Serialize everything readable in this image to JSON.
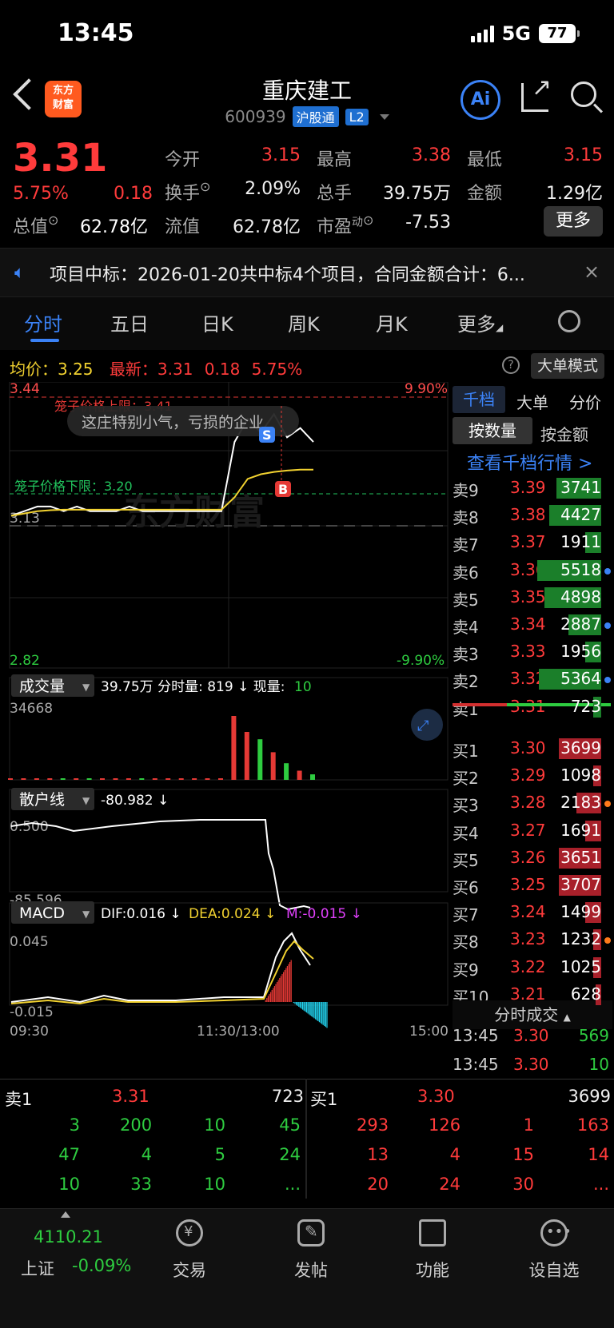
{
  "status": {
    "time": "13:45",
    "network": "5G",
    "battery": "77"
  },
  "header": {
    "logo_line1": "东方",
    "logo_line2": "财富",
    "name": "重庆建工",
    "code": "600939",
    "tag1": "沪股通",
    "tag2": "L2",
    "ai_label": "Ai"
  },
  "quote": {
    "price": "3.31",
    "pct": "5.75%",
    "change": "0.18",
    "open_label": "今开",
    "open": "3.15",
    "high_label": "最高",
    "high": "3.38",
    "low_label": "最低",
    "low": "3.15",
    "turnover_label": "换手",
    "turnover": "2.09%",
    "volume_label": "总手",
    "volume": "39.75万",
    "amount_label": "金额",
    "amount": "1.29亿",
    "mktcap_label": "总值",
    "mktcap": "62.78亿",
    "float_label": "流值",
    "float": "62.78亿",
    "pe_label": "市盈",
    "pe_sup": "动",
    "pe": "-7.53",
    "more": "更多"
  },
  "notice": {
    "text": "项目中标：2026-01-20共中标4个项目，合同金额合计：6...",
    "close": "×"
  },
  "tabs": [
    "分时",
    "五日",
    "日K",
    "周K",
    "月K",
    "更多"
  ],
  "chart_head": {
    "avg_label": "均价：",
    "avg": "3.25",
    "last_label": "最新：",
    "last": "3.31",
    "chg": "0.18",
    "pct": "5.75%",
    "big_order": "大单模式",
    "help": "?"
  },
  "chart_labels": {
    "y_top": "3.44",
    "y_mid": "3.13",
    "y_bot": "2.82",
    "pct_top": "9.90%",
    "pct_bot": "-9.90%",
    "upper_limit": "笼子价格上限：3.41",
    "lower_limit": "笼子价格下限：3.20",
    "toast": "这庄特别小气，亏损的企业",
    "watermark": "东方财富",
    "vol_title": "成交量",
    "vol_info": "39.75万 分时量: 819 ↓ 现量: ",
    "vol_now": "10",
    "vol_max": "34668",
    "retail_title": "散户线",
    "retail_val": "-80.982 ↓",
    "retail_top": "0.500",
    "retail_bot": "-85.596",
    "macd_title": "MACD",
    "dif": "DIF:0.016 ↓",
    "dea": "DEA:0.024 ↓",
    "m": "M:-0.015 ↓",
    "macd_top": "0.045",
    "macd_bot": "-0.015",
    "t_start": "09:30",
    "t_mid": "11:30/13:00",
    "t_end": "15:00",
    "marker_s": "S",
    "marker_b": "B"
  },
  "chart_data": {
    "type": "line",
    "title": "",
    "price_range": [
      2.82,
      3.44
    ],
    "prev_close": 3.13,
    "series": [
      {
        "name": "最新",
        "values": [
          3.15,
          3.16,
          3.17,
          3.17,
          3.16,
          3.17,
          3.16,
          3.16,
          3.16,
          3.17,
          3.16,
          3.16,
          3.16,
          3.16,
          3.16,
          3.16,
          3.16,
          3.31,
          3.36,
          3.33,
          3.37,
          3.32,
          3.34,
          3.31
        ]
      },
      {
        "name": "均价",
        "values": [
          3.15,
          3.155,
          3.16,
          3.162,
          3.163,
          3.163,
          3.163,
          3.163,
          3.163,
          3.163,
          3.163,
          3.163,
          3.163,
          3.163,
          3.163,
          3.163,
          3.163,
          3.19,
          3.23,
          3.24,
          3.245,
          3.248,
          3.25,
          3.25
        ]
      }
    ],
    "volume": [
      40,
      80,
      20,
      30,
      60,
      20,
      30,
      40,
      20,
      30,
      20,
      20,
      15,
      15,
      20,
      15,
      10,
      34668,
      26000,
      22000,
      15000,
      9000,
      5000,
      3000
    ],
    "ylim": [
      2.82,
      3.44
    ]
  },
  "panel": {
    "tab1": "千档",
    "tab2": "大单",
    "tab3": "分价",
    "by_qty": "按数量",
    "by_amt": "按金额",
    "view_link": "查看千档行情 >",
    "asks": [
      {
        "label": "卖9",
        "price": "3.39",
        "vol": "3741",
        "bar": 0.33,
        "dot": ""
      },
      {
        "label": "卖8",
        "price": "3.38",
        "vol": "4427",
        "bar": 0.38,
        "dot": ""
      },
      {
        "label": "卖7",
        "price": "3.37",
        "vol": "1911",
        "bar": 0.12,
        "dot": ""
      },
      {
        "label": "卖6",
        "price": "3.36",
        "vol": "5518",
        "bar": 0.47,
        "dot": "#3b82f6"
      },
      {
        "label": "卖5",
        "price": "3.35",
        "vol": "4898",
        "bar": 0.42,
        "dot": ""
      },
      {
        "label": "卖4",
        "price": "3.34",
        "vol": "2887",
        "bar": 0.24,
        "dot": "#3b82f6"
      },
      {
        "label": "卖3",
        "price": "3.33",
        "vol": "1956",
        "bar": 0.12,
        "dot": ""
      },
      {
        "label": "卖2",
        "price": "3.32",
        "vol": "5364",
        "bar": 0.46,
        "dot": "#3b82f6"
      },
      {
        "label": "卖1",
        "price": "3.31",
        "vol": "723",
        "bar": 0.06,
        "dot": ""
      }
    ],
    "bids": [
      {
        "label": "买1",
        "price": "3.30",
        "vol": "3699",
        "bar": 0.31,
        "dot": ""
      },
      {
        "label": "买2",
        "price": "3.29",
        "vol": "1098",
        "bar": 0.06,
        "dot": ""
      },
      {
        "label": "买3",
        "price": "3.28",
        "vol": "2183",
        "bar": 0.18,
        "dot": "#ff7a1a"
      },
      {
        "label": "买4",
        "price": "3.27",
        "vol": "1691",
        "bar": 0.12,
        "dot": ""
      },
      {
        "label": "买5",
        "price": "3.26",
        "vol": "3651",
        "bar": 0.31,
        "dot": ""
      },
      {
        "label": "买6",
        "price": "3.25",
        "vol": "3707",
        "bar": 0.31,
        "dot": ""
      },
      {
        "label": "买7",
        "price": "3.24",
        "vol": "1499",
        "bar": 0.12,
        "dot": ""
      },
      {
        "label": "买8",
        "price": "3.23",
        "vol": "1232",
        "bar": 0.06,
        "dot": "#ff7a1a"
      },
      {
        "label": "买9",
        "price": "3.22",
        "vol": "1025",
        "bar": 0.06,
        "dot": ""
      },
      {
        "label": "买10",
        "price": "3.21",
        "vol": "628",
        "bar": 0.04,
        "dot": ""
      }
    ],
    "tick_header": "分时成交",
    "ticks": [
      {
        "time": "13:45",
        "price": "3.30",
        "vol": "569"
      },
      {
        "time": "13:45",
        "price": "3.30",
        "vol": "10"
      }
    ]
  },
  "trades": {
    "sell_label": "卖1",
    "sell_price": "3.31",
    "sell_vol": "723",
    "buy_label": "买1",
    "buy_price": "3.30",
    "buy_vol": "3699",
    "sell_rows": [
      [
        "3",
        "200",
        "10",
        "45"
      ],
      [
        "47",
        "4",
        "5",
        "24"
      ],
      [
        "10",
        "33",
        "10",
        "..."
      ]
    ],
    "buy_rows": [
      [
        "293",
        "126",
        "1",
        "163"
      ],
      [
        "13",
        "4",
        "15",
        "14"
      ],
      [
        "20",
        "24",
        "30",
        "..."
      ]
    ]
  },
  "nav": {
    "index_value": "4110.21",
    "index_name": "上证",
    "index_pct": "-0.09%",
    "trade": "交易",
    "post": "发帖",
    "func": "功能",
    "watch": "设自选"
  }
}
